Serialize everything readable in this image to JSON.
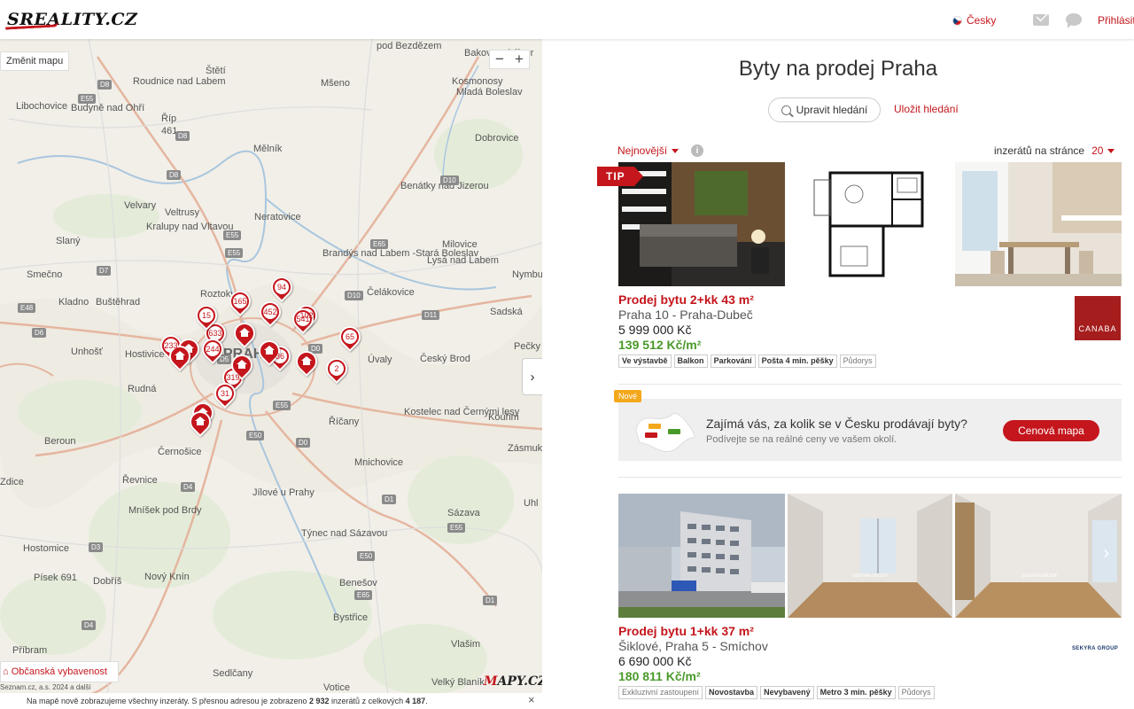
{
  "header": {
    "logo": "SREALITY.CZ",
    "language": "Česky",
    "login": "Přihlásit"
  },
  "map": {
    "change_map": "Změnit mapu",
    "zoom_out": "−",
    "zoom_in": "+",
    "collapse": "›",
    "amenities": "Občanská vybavenost",
    "copyright": "Seznam.cz, a.s. 2024 a další",
    "logo_prefix": "M",
    "logo_rest": "APY.CZ",
    "info_prefix": "Na mapě nově zobrazujeme všechny inzeráty. S přesnou adresou je zobrazeno ",
    "info_count": "2 932",
    "info_middle": " inzerátů z celkových ",
    "info_total": "4 187",
    "info_suffix": ".",
    "info_close": "×",
    "places": [
      "pod Bezdězem",
      "Bakov nad Jizer",
      "Štětí",
      "Roudnice nad Labem",
      "Mšeno",
      "Kosmonosy",
      "Mladá Boleslav",
      "Libochovice",
      "Budyně nad Ohří",
      "Říp",
      "461",
      "Mělník",
      "Dobrovice",
      "Benátky nad Jizerou",
      "Velvary",
      "Veltrusy",
      "Neratovice",
      "Kralupy nad Vltavou",
      "Slaný",
      "Brandýs nad Labem -Stará Boleslav",
      "Milovice",
      "Lysá nad Labem",
      "Smečno",
      "Nymbu",
      "Roztoky",
      "Čelákovice",
      "Kladno",
      "Buštěhrad",
      "Sadská",
      "Unhošť",
      "Hostivice",
      "PRAHA",
      "Úvaly",
      "Český Brod",
      "Pečky",
      "Rudná",
      "Říčany",
      "Kostelec nad Černými lesy",
      "Kouřim",
      "Beroun",
      "Černošice",
      "Mnichovice",
      "Zásmuk",
      "Řevnice",
      "Jílové u Prahy",
      "Zdice",
      "Mníšek pod Brdy",
      "Sázava",
      "Uhl",
      "Týnec nad Sázavou",
      "Hostomice",
      "Písek 691",
      "Dobříš",
      "Nový Knín",
      "Benešov",
      "Bystřice",
      "Vlašim",
      "Příbram",
      "Sedlčany",
      "Votice",
      "Velký Blaník"
    ],
    "roads": [
      "D8",
      "E55",
      "D8",
      "D8",
      "E55",
      "D10",
      "E55",
      "D7",
      "E65",
      "D10",
      "E48",
      "D6",
      "D11",
      "D0",
      "D5",
      "E50",
      "E55",
      "D0",
      "D1",
      "D4",
      "D3",
      "E50",
      "D1",
      "D4",
      "E65",
      "E55"
    ],
    "pins": [
      {
        "label": "94"
      },
      {
        "label": "165"
      },
      {
        "label": "452"
      },
      {
        "label": "102"
      },
      {
        "label": "541"
      },
      {
        "label": "633"
      },
      {
        "label": ""
      },
      {
        "label": "15"
      },
      {
        "label": "65"
      },
      {
        "label": "233"
      },
      {
        "label": ""
      },
      {
        "label": "244"
      },
      {
        "label": "36"
      },
      {
        "label": ""
      },
      {
        "label": "2"
      },
      {
        "label": ""
      },
      {
        "label": "319"
      },
      {
        "label": ""
      },
      {
        "label": "31"
      },
      {
        "label": ""
      },
      {
        "label": ""
      },
      {
        "label": ""
      }
    ]
  },
  "panel": {
    "title": "Byty na prodej Praha",
    "edit_search": "Upravit hledání",
    "save_search": "Uložit hledání",
    "sort_label": "Nejnovější",
    "info": "i",
    "per_page_label": "inzerátů na stránce",
    "per_page_value": "20"
  },
  "listings": [
    {
      "tip": "TIP",
      "title": "Prodej bytu 2+kk 43 m²",
      "location": "Praha 10 - Praha-Dubeč",
      "price": "5 999 000 Kč",
      "price_per_m2": "139 512 Kč/m²",
      "tags": [
        "Ve výstavbě",
        "Balkon",
        "Parkování",
        "Pošta 4 min. pěšky",
        "Půdorys"
      ],
      "agency": "CANABA"
    },
    {
      "title": "Prodej bytu 1+kk 37 m²",
      "location": "Šiklové, Praha 5 - Smíchov",
      "price": "6 690 000 Kč",
      "price_per_m2": "180 811 Kč/m²",
      "tags": [
        "Exkluzivní zastoupení",
        "Novostavba",
        "Nevybavený",
        "Metro 3 min. pěšky",
        "Půdorys"
      ],
      "agency": "SEKYRA GROUP",
      "photo_watermark": "SEKYRA GROUP",
      "next": "›"
    }
  ],
  "promo": {
    "badge": "Nové",
    "question": "Zajímá vás, za kolik se v Česku prodávají byty?",
    "subtitle": "Podívejte se na reálné ceny ve vašem okolí.",
    "button": "Cenová mapa"
  },
  "colors": {
    "accent": "#c4161c",
    "price_green": "#4a9a2a",
    "badge_yellow": "#f3a81c"
  }
}
